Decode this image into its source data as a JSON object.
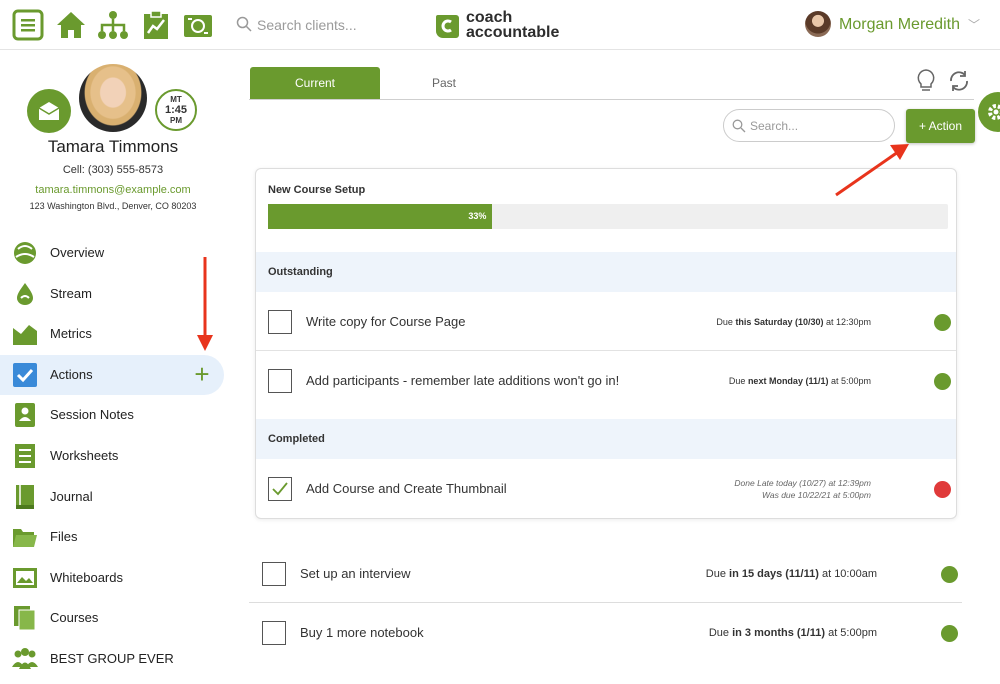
{
  "colors": {
    "brand_green": "#6a9a2e",
    "status_green": "#6a9a2e",
    "status_red": "#e03a3a",
    "active_bg": "#e6f0fb"
  },
  "topbar": {
    "icons": [
      "menu-icon",
      "home-icon",
      "org-chart-icon",
      "clipboard-chart-icon",
      "money-icon"
    ],
    "search_placeholder": "Search clients...",
    "logo_line1": "coach",
    "logo_line2": "accountable",
    "user_name": "Morgan Meredith",
    "user_chevron": "﹀"
  },
  "client": {
    "name": "Tamara Timmons",
    "cell": "Cell:  (303) 555-8573",
    "email": "tamara.timmons@example.com",
    "address": "123 Washington Blvd., Denver, CO 80203",
    "timezone": {
      "zone": "MT",
      "time": "1:45",
      "ampm": "PM"
    }
  },
  "nav": {
    "items": [
      {
        "label": "Overview",
        "icon": "overview-icon"
      },
      {
        "label": "Stream",
        "icon": "stream-icon"
      },
      {
        "label": "Metrics",
        "icon": "metrics-icon"
      },
      {
        "label": "Actions",
        "icon": "checkbox-icon",
        "active": true
      },
      {
        "label": "Session Notes",
        "icon": "session-notes-icon"
      },
      {
        "label": "Worksheets",
        "icon": "worksheets-icon"
      },
      {
        "label": "Journal",
        "icon": "journal-icon"
      },
      {
        "label": "Files",
        "icon": "files-icon"
      },
      {
        "label": "Whiteboards",
        "icon": "whiteboards-icon"
      },
      {
        "label": "Courses",
        "icon": "courses-icon"
      },
      {
        "label": "BEST GROUP EVER",
        "icon": "group-icon"
      }
    ],
    "add_symbol": "+"
  },
  "tabs": {
    "current": "Current",
    "past": "Past"
  },
  "search": {
    "placeholder": "Search..."
  },
  "add_action_label": "+ Action",
  "course": {
    "title": "New Course Setup",
    "progress_fraction": 0.33,
    "progress_label": "33%",
    "outstanding_header": "Outstanding",
    "completed_header": "Completed",
    "outstanding": [
      {
        "title": "Write copy for Course Page",
        "due_pre": "Due ",
        "due_bold": "this Saturday (10/30)",
        "due_post": " at 12:30pm",
        "status": "green"
      },
      {
        "title": "Add participants - remember late additions won't go in!",
        "due_pre": "Due ",
        "due_bold": "next Monday (11/1)",
        "due_post": " at 5:00pm",
        "status": "green"
      }
    ],
    "completed": [
      {
        "title": "Add Course and Create Thumbnail",
        "done_line1": "Done Late today (10/27) at 12:39pm",
        "done_line2": "Was due 10/22/21 at 5:00pm",
        "status": "red"
      }
    ]
  },
  "other_actions": [
    {
      "title": "Set up an interview",
      "due_pre": "Due ",
      "due_bold": "in 15 days (11/11)",
      "due_post": " at 10:00am",
      "status": "green"
    },
    {
      "title": "Buy 1 more notebook",
      "due_pre": "Due ",
      "due_bold": "in 3 months (1/11)",
      "due_post": " at 5:00pm",
      "status": "green"
    }
  ]
}
